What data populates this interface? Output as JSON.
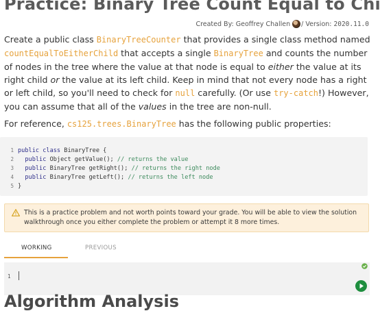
{
  "page": {
    "title": "Practice: Binary Tree Count Equal to Child"
  },
  "byline": {
    "created_by_label": "Created By:",
    "author": "Geoffrey Challen",
    "version_label": "Version:",
    "version": "2020.11.0"
  },
  "description": {
    "p1": [
      "Create a public class ",
      "BinaryTreeCounter",
      " that provides a single class method named ",
      "countEqualToEitherChild",
      " that accepts a single ",
      "BinaryTree",
      " and counts the number of nodes in the tree where the value at that node is equal to ",
      "either",
      " the value at its right child ",
      "or",
      " the value at its left child. Keep in mind that not every node has a right or left child, so you'll need to check for ",
      "null",
      " carefully. (Or use ",
      "try-catch",
      "!) However, you can assume that all of the ",
      "values",
      " in the tree are non-null."
    ],
    "p2": [
      "For reference, ",
      "cs125.trees.BinaryTree",
      " has the following public properties:"
    ]
  },
  "code_sample": {
    "lines": [
      {
        "num": "1",
        "kw": "public class",
        "rest": " BinaryTree {",
        "comment": ""
      },
      {
        "num": "2",
        "kw": "  public",
        "rest": " Object getValue(); ",
        "comment": "// returns the value"
      },
      {
        "num": "3",
        "kw": "  public",
        "rest": " BinaryTree getRight(); ",
        "comment": "// returns the right node"
      },
      {
        "num": "4",
        "kw": "  public",
        "rest": " BinaryTree getLeft(); ",
        "comment": "// returns the left node"
      },
      {
        "num": "5",
        "kw": "",
        "rest": "}",
        "comment": ""
      }
    ]
  },
  "notice": {
    "text": "This is a practice problem and not worth points toward your grade. You will be able to view the solution walkthrough once you either complete the problem or attempt it 8 more times."
  },
  "tabs": {
    "working": "WORKING",
    "previous": "PREVIOUS"
  },
  "editor": {
    "line_number": "1"
  },
  "next_section": {
    "heading": "Algorithm Analysis"
  },
  "colors": {
    "accent": "#e6a23c",
    "run": "#1e8e3e",
    "notice_bg": "#fdf0dc"
  },
  "icons": {
    "warning": "warning-icon",
    "check": "check-circle-icon",
    "run": "play-icon"
  }
}
